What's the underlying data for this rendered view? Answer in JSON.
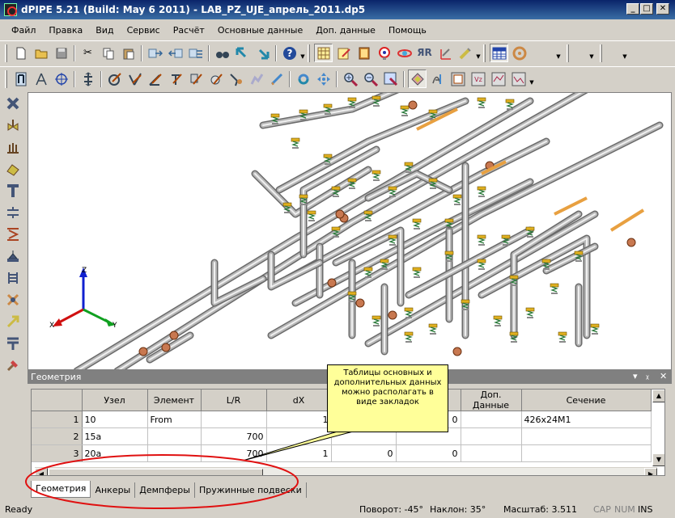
{
  "window": {
    "title": "dPIPE 5.21 (Build: May  6 2011) - LAB_PZ_UJE_апрель_2011.dp5",
    "minimize": "_",
    "maximize": "□",
    "close": "✕"
  },
  "menu": [
    "Файл",
    "Правка",
    "Вид",
    "Сервис",
    "Расчёт",
    "Основные данные",
    "Доп. данные",
    "Помощь"
  ],
  "toolbar1_icons": [
    "new-file-icon",
    "open-folder-icon",
    "save-icon",
    "cut-icon",
    "copy-icon",
    "paste-icon",
    "move-right-icon",
    "move-left-icon",
    "move-down-icon",
    "binoculars-icon",
    "cursor-select-icon",
    "cursor-move-icon",
    "help-icon",
    "grid-view-icon",
    "edit-note-icon",
    "book-icon",
    "circle-target-icon",
    "sphere-icon",
    "mirror-icon",
    "axis-icon",
    "pencil-icon",
    "table-icon",
    "circle-icon"
  ],
  "toolbar2_icons": [
    "pointer-icon",
    "compass-icon",
    "crosshair-icon",
    "scale-icon",
    "node-edit-icon",
    "element-edit-icon",
    "slope-icon",
    "bend-icon",
    "flag-icon",
    "branch-icon",
    "measure-icon",
    "snap-icon",
    "rotate-icon",
    "pan-icon",
    "zoom-in-icon",
    "zoom-out-icon",
    "zoom-window-icon",
    "shaded-view-icon",
    "wireframe-icon",
    "report-icon",
    "stress-icon",
    "sz-icon",
    "sy-icon"
  ],
  "left_toolbar_icons": [
    "delete-node-icon",
    "valve-icon",
    "anchor-icon",
    "reducer-icon",
    "tee-icon",
    "flange-icon",
    "spring-icon",
    "nozzle-icon",
    "expansion-joint-icon",
    "cross-icon",
    "arrow-icon",
    "support-icon",
    "hammer-icon"
  ],
  "axes": {
    "z": "Z",
    "x": "X",
    "y": "Y"
  },
  "panel": {
    "title": "Геометрия",
    "controls": [
      "▾",
      "ᵪ",
      "✕"
    ],
    "columns": [
      "",
      "Узел",
      "Элемент",
      "L/R",
      "dX",
      "",
      "",
      "Доп. Данные",
      "Сечение"
    ],
    "rows": [
      {
        "num": "1",
        "node": "10",
        "element": "From",
        "lr": "",
        "dx": "1",
        "c5": "",
        "c6": "0",
        "extra": "",
        "section": "426x24M1"
      },
      {
        "num": "2",
        "node": "15a",
        "element": "",
        "lr": "700",
        "dx": "",
        "c5": "",
        "c6": "",
        "extra": "",
        "section": ""
      },
      {
        "num": "3",
        "node": "20a",
        "element": "",
        "lr": "700",
        "dx": "1",
        "c5": "0",
        "c6": "0",
        "extra": "",
        "section": ""
      }
    ],
    "tabs": [
      "Геометрия",
      "Анкеры",
      "Демпферы",
      "Пружинные подвески"
    ]
  },
  "callout": "Таблицы основных и дополнительных данных можно располагать в виде закладок",
  "status": {
    "ready": "Ready",
    "rotation": "Поворот: -45°",
    "tilt": "Наклон: 35°",
    "scale": "Масштаб: 3.511",
    "cap": "CAP",
    "num": "NUM",
    "ins": "INS"
  },
  "colors": {
    "titlebar": "#0a246a",
    "pipe": "#b8b8b8",
    "hanger": "#e0b020",
    "valve": "#c87850",
    "annotation_ellipse": "#e01010",
    "callout_bg": "#ffff99"
  }
}
